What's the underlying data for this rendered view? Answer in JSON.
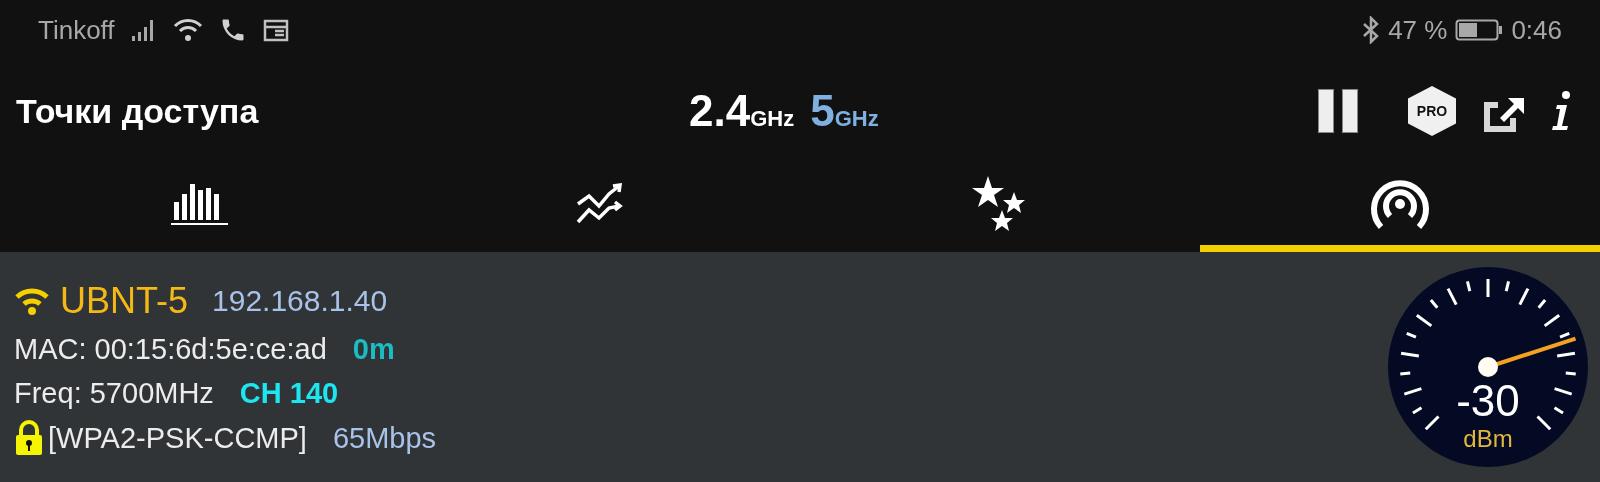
{
  "status_bar": {
    "carrier": "Tinkoff",
    "battery_percent": "47 %",
    "time": "0:46"
  },
  "app_bar": {
    "title": "Точки доступа",
    "pro_badge": "PRO",
    "bands": [
      {
        "number": "2.4",
        "unit": "GHz",
        "selected": false
      },
      {
        "number": "5",
        "unit": "GHz",
        "selected": true
      }
    ]
  },
  "tabs": [
    {
      "kind": "bars",
      "selected": false
    },
    {
      "kind": "trend",
      "selected": false
    },
    {
      "kind": "stars",
      "selected": false
    },
    {
      "kind": "signal",
      "selected": true
    }
  ],
  "network": {
    "ssid": "UBNT-5",
    "ip": "192.168.1.40",
    "mac": "MAC: 00:15:6d:5e:ce:ad",
    "distance": "0m",
    "freq": "Freq: 5700MHz",
    "channel": "CH 140",
    "security": "[WPA2-PSK-CCMP]",
    "speed": "65Mbps",
    "meter": {
      "reading": "-30",
      "unit": "dBm"
    }
  }
}
